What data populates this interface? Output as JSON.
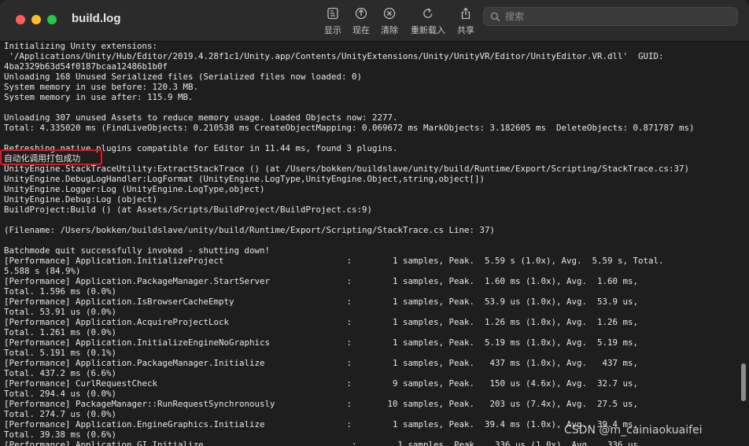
{
  "window": {
    "title": "build.log"
  },
  "toolbar": {
    "show_label": "显示",
    "now_label": "现在",
    "clear_label": "清除",
    "reload_label": "重新载入",
    "share_label": "共享"
  },
  "search": {
    "placeholder": "搜索"
  },
  "log": {
    "highlight_color": "#e8141b",
    "lines": [
      "Initializing Unity extensions:",
      " '/Applications/Unity/Hub/Editor/2019.4.28f1c1/Unity.app/Contents/UnityExtensions/Unity/UnityVR/Editor/UnityEditor.VR.dll'  GUID:",
      "4ba2329b63d54f0187bcaa12486b1b0f",
      "Unloading 168 Unused Serialized files (Serialized files now loaded: 0)",
      "System memory in use before: 120.3 MB.",
      "System memory in use after: 115.9 MB.",
      "",
      "Unloading 307 unused Assets to reduce memory usage. Loaded Objects now: 2277.",
      "Total: 4.335020 ms (FindLiveObjects: 0.210538 ms CreateObjectMapping: 0.069672 ms MarkObjects: 3.182605 ms  DeleteObjects: 0.871787 ms)",
      "",
      "Refreshing native plugins compatible for Editor in 11.44 ms, found 3 plugins.",
      "自动化调用打包成功",
      "UnityEngine.StackTraceUtility:ExtractStackTrace () (at /Users/bokken/buildslave/unity/build/Runtime/Export/Scripting/StackTrace.cs:37)",
      "UnityEngine.DebugLogHandler:LogFormat (UnityEngine.LogType,UnityEngine.Object,string,object[])",
      "UnityEngine.Logger:Log (UnityEngine.LogType,object)",
      "UnityEngine.Debug:Log (object)",
      "BuildProject:Build () (at Assets/Scripts/BuildProject/BuildProject.cs:9)",
      "",
      "(Filename: /Users/bokken/buildslave/unity/build/Runtime/Export/Scripting/StackTrace.cs Line: 37)",
      "",
      "Batchmode quit successfully invoked - shutting down!",
      "[Performance] Application.InitializeProject                        :        1 samples, Peak.  5.59 s (1.0x), Avg.  5.59 s, Total.",
      "5.588 s (84.9%)",
      "[Performance] Application.PackageManager.StartServer               :        1 samples, Peak.  1.60 ms (1.0x), Avg.  1.60 ms,",
      "Total. 1.596 ms (0.0%)",
      "[Performance] Application.IsBrowserCacheEmpty                      :        1 samples, Peak.  53.9 us (1.0x), Avg.  53.9 us,",
      "Total. 53.91 us (0.0%)",
      "[Performance] Application.AcquireProjectLock                       :        1 samples, Peak.  1.26 ms (1.0x), Avg.  1.26 ms,",
      "Total. 1.261 ms (0.0%)",
      "[Performance] Application.InitializeEngineNoGraphics               :        1 samples, Peak.  5.19 ms (1.0x), Avg.  5.19 ms,",
      "Total. 5.191 ms (0.1%)",
      "[Performance] Application.PackageManager.Initialize                :        1 samples, Peak.   437 ms (1.0x), Avg.   437 ms,",
      "Total. 437.2 ms (6.6%)",
      "[Performance] CurlRequestCheck                                     :        9 samples, Peak.   150 us (4.6x), Avg.  32.7 us,",
      "Total. 294.4 us (0.0%)",
      "[Performance] PackageManager::RunRequestSynchronously              :       10 samples, Peak.   203 us (7.4x), Avg.  27.5 us,",
      "Total. 274.7 us (0.0%)",
      "[Performance] Application.EngineGraphics.Initialize                :        1 samples, Peak.  39.4 ms (1.0x), Avg.  39.4 ms,",
      "Total. 39.38 ms (0.6%)",
      "[Performance] Application.GI.Initialize                             :        1 samples, Peak.   336 us (1.0x), Avg.   336 us,"
    ]
  },
  "watermark": "CSDN @m_cainiaokuaifei"
}
